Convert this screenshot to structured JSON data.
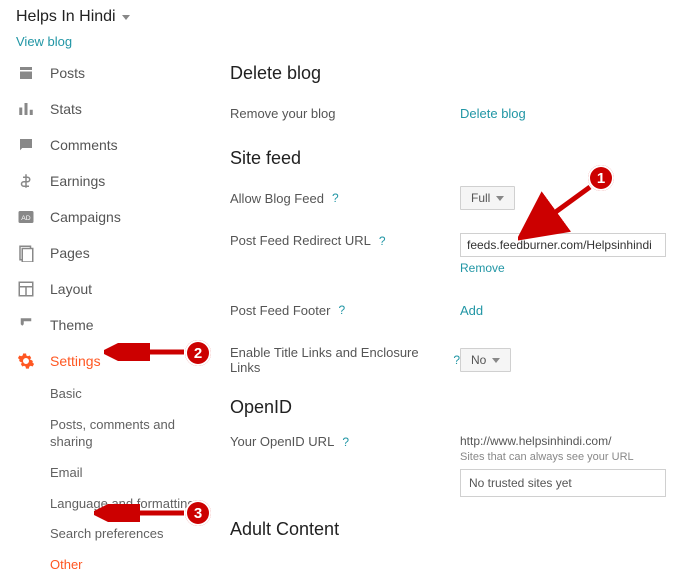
{
  "header": {
    "blog_title": "Helps In Hindi",
    "view_blog": "View blog"
  },
  "sidebar": {
    "items": [
      {
        "label": "Posts"
      },
      {
        "label": "Stats"
      },
      {
        "label": "Comments"
      },
      {
        "label": "Earnings"
      },
      {
        "label": "Campaigns"
      },
      {
        "label": "Pages"
      },
      {
        "label": "Layout"
      },
      {
        "label": "Theme"
      },
      {
        "label": "Settings",
        "active": true
      }
    ],
    "subitems": [
      {
        "label": "Basic"
      },
      {
        "label": "Posts, comments and sharing"
      },
      {
        "label": "Email"
      },
      {
        "label": "Language and formatting"
      },
      {
        "label": "Search preferences"
      },
      {
        "label": "Other",
        "active": true
      }
    ]
  },
  "main": {
    "delete_blog": {
      "title": "Delete blog",
      "row_label": "Remove your blog",
      "action": "Delete blog"
    },
    "site_feed": {
      "title": "Site feed",
      "allow_label": "Allow Blog Feed",
      "allow_value": "Full",
      "redirect_label": "Post Feed Redirect URL",
      "redirect_value": "feeds.feedburner.com/Helpsinhindi",
      "remove": "Remove",
      "footer_label": "Post Feed Footer",
      "footer_action": "Add",
      "enable_label": "Enable Title Links and Enclosure Links",
      "enable_value": "No"
    },
    "openid": {
      "title": "OpenID",
      "url_label": "Your OpenID URL",
      "url_value": "http://www.helpsinhindi.com/",
      "caption": "Sites that can always see your URL",
      "box": "No trusted sites yet"
    },
    "adult": {
      "title": "Adult Content"
    },
    "help": "?"
  },
  "annotations": {
    "b1": "1",
    "b2": "2",
    "b3": "3"
  }
}
